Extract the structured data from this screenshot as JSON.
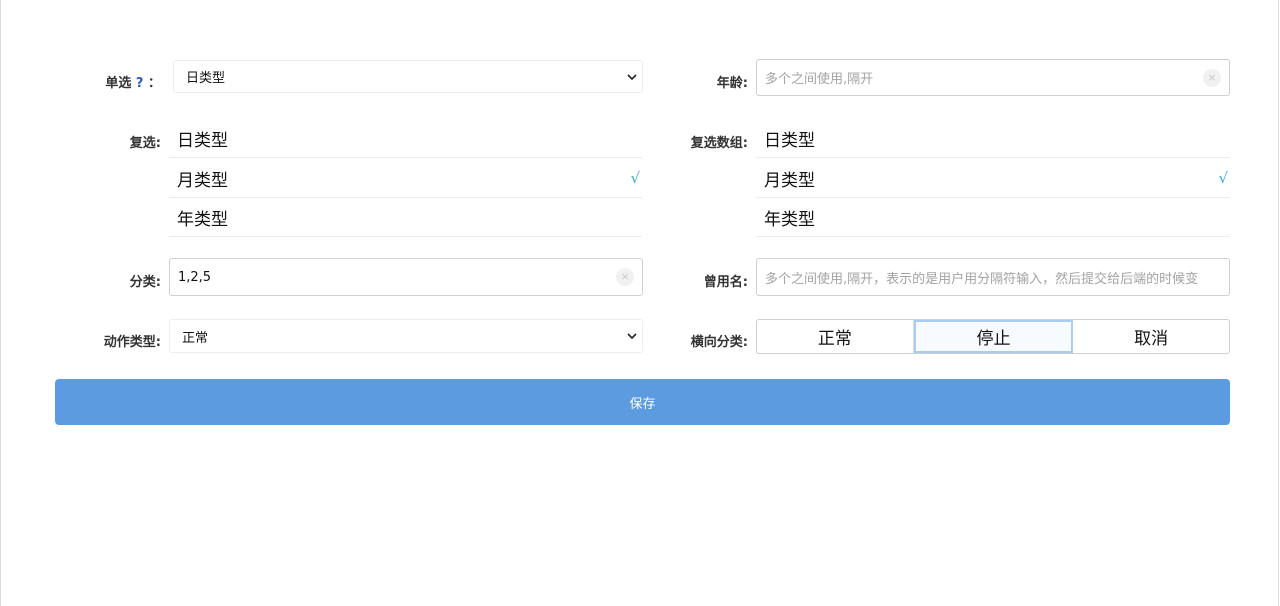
{
  "form": {
    "single": {
      "label": "单选",
      "help": "?",
      "colon": "：",
      "value": "日类型"
    },
    "age": {
      "label": "年龄:",
      "placeholder": "多个之间使用,隔开",
      "clear_icon": "×"
    },
    "multi": {
      "label": "复选:",
      "options": [
        {
          "label": "日类型",
          "checked": false
        },
        {
          "label": "月类型",
          "checked": true
        },
        {
          "label": "年类型",
          "checked": false
        }
      ]
    },
    "multi_array": {
      "label": "复选数组:",
      "options": [
        {
          "label": "日类型",
          "checked": false
        },
        {
          "label": "月类型",
          "checked": true
        },
        {
          "label": "年类型",
          "checked": false
        }
      ]
    },
    "check_mark": "√",
    "category": {
      "label": "分类:",
      "value": "1,2,5",
      "clear_icon": "×"
    },
    "alias": {
      "label": "曾用名:",
      "placeholder": "多个之间使用,隔开，表示的是用户用分隔符输入，然后提交给后端的时候变"
    },
    "action_type": {
      "label": "动作类型:",
      "value": "正常"
    },
    "horizontal": {
      "label": "横向分类:",
      "options": [
        "正常",
        "停止",
        "取消"
      ],
      "active": "停止"
    },
    "save_label": "保存"
  },
  "colors": {
    "accent": "#5d9be0",
    "check": "#39a8d9",
    "help": "#2a5dc4"
  }
}
